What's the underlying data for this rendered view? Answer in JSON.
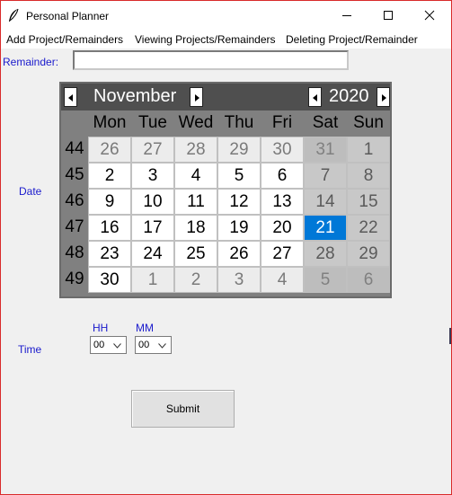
{
  "window": {
    "title": "Personal Planner"
  },
  "menu": [
    "Add Project/Remainders",
    "Viewing Projects/Remainders",
    "Deleting Project/Remainder"
  ],
  "form": {
    "reminder_label": "Remainder:",
    "reminder_value": "",
    "date_label": "Date",
    "time_label": "Time",
    "hh_label": "HH",
    "mm_label": "MM",
    "hh_value": "00",
    "mm_value": "00",
    "submit_label": "Submit"
  },
  "calendar": {
    "month": "November",
    "year": "2020",
    "weekdays": [
      "Mon",
      "Tue",
      "Wed",
      "Thu",
      "Fri",
      "Sat",
      "Sun"
    ],
    "weeks": [
      {
        "num": "44",
        "days": [
          "26",
          "27",
          "28",
          "29",
          "30",
          "31",
          "1"
        ]
      },
      {
        "num": "45",
        "days": [
          "2",
          "3",
          "4",
          "5",
          "6",
          "7",
          "8"
        ]
      },
      {
        "num": "46",
        "days": [
          "9",
          "10",
          "11",
          "12",
          "13",
          "14",
          "15"
        ]
      },
      {
        "num": "47",
        "days": [
          "16",
          "17",
          "18",
          "19",
          "20",
          "21",
          "22"
        ]
      },
      {
        "num": "48",
        "days": [
          "23",
          "24",
          "25",
          "26",
          "27",
          "28",
          "29"
        ]
      },
      {
        "num": "49",
        "days": [
          "30",
          "1",
          "2",
          "3",
          "4",
          "5",
          "6"
        ]
      }
    ],
    "selected_day": "21",
    "colors": {
      "selected": "#0078d7",
      "header": "#4f4f4f"
    }
  }
}
